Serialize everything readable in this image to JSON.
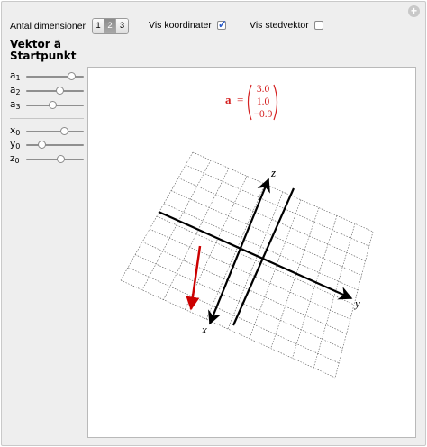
{
  "controls": {
    "dimensions_label": "Antal dimensioner",
    "dimension_options": [
      "1",
      "2",
      "3"
    ],
    "dimension_selected": "2",
    "show_coords_label": "Vis koordinater",
    "show_coords_checked": true,
    "show_position_label": "Vis stedvektor",
    "show_position_checked": false
  },
  "section": {
    "vector_title": "Vektor a⃗",
    "start_title": "Startpunkt"
  },
  "sliders_vector": [
    {
      "base": "a",
      "sub": "1",
      "value": 0.78
    },
    {
      "base": "a",
      "sub": "2",
      "value": 0.58
    },
    {
      "base": "a",
      "sub": "3",
      "value": 0.45
    }
  ],
  "sliders_start": [
    {
      "base": "x",
      "sub": "0",
      "value": 0.66
    },
    {
      "base": "y",
      "sub": "0",
      "value": 0.26
    },
    {
      "base": "z",
      "sub": "0",
      "value": 0.6
    }
  ],
  "plot": {
    "vector_label": "a⃗",
    "equals": "=",
    "components": [
      "3.0",
      "1.0",
      "−0.9"
    ],
    "axis_labels": {
      "x": "x",
      "y": "y",
      "z": "z"
    },
    "vector_color": "#cc0000",
    "accent_color": "#d42020"
  }
}
